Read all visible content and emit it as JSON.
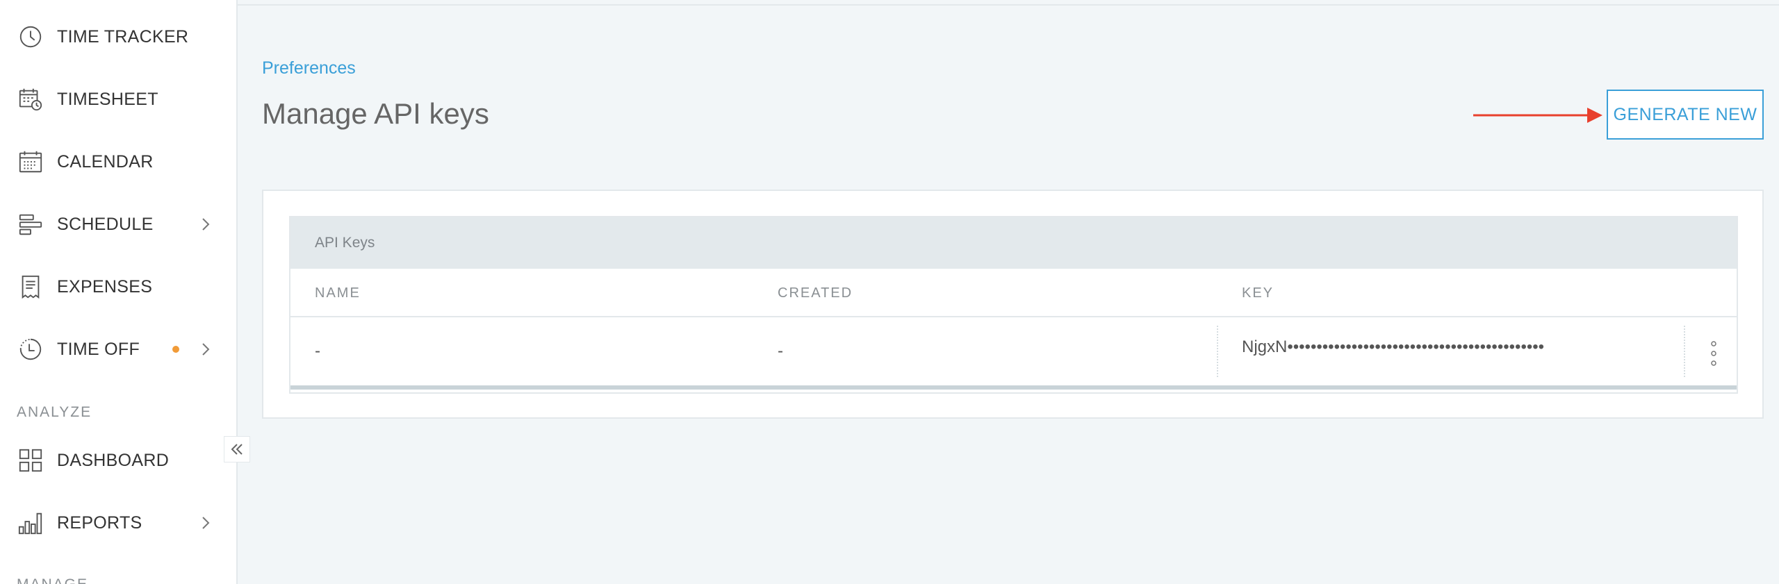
{
  "sidebar": {
    "items": [
      {
        "label": "TIME TRACKER",
        "icon": "clock-icon"
      },
      {
        "label": "TIMESHEET",
        "icon": "timesheet-icon"
      },
      {
        "label": "CALENDAR",
        "icon": "calendar-icon"
      },
      {
        "label": "SCHEDULE",
        "icon": "schedule-icon"
      },
      {
        "label": "EXPENSES",
        "icon": "receipt-icon"
      },
      {
        "label": "TIME OFF",
        "icon": "time-off-icon"
      },
      {
        "label": "DASHBOARD",
        "icon": "dashboard-icon"
      },
      {
        "label": "REPORTS",
        "icon": "bar-chart-icon"
      }
    ],
    "section_analyze": "ANALYZE",
    "section_manage": "MANAGE"
  },
  "header": {
    "breadcrumb": "Preferences",
    "title": "Manage API keys",
    "generate_label": "GENERATE NEW"
  },
  "table": {
    "caption": "API Keys",
    "columns": [
      "NAME",
      "CREATED",
      "KEY"
    ],
    "rows": [
      {
        "name": "-",
        "created": "-",
        "key": "NjgxN••••••••••••••••••••••••••••••••••••••••••••"
      }
    ]
  },
  "colors": {
    "accent": "#3a9fd8",
    "annotation_arrow": "#e8402d",
    "notification_dot": "#f19b38"
  }
}
